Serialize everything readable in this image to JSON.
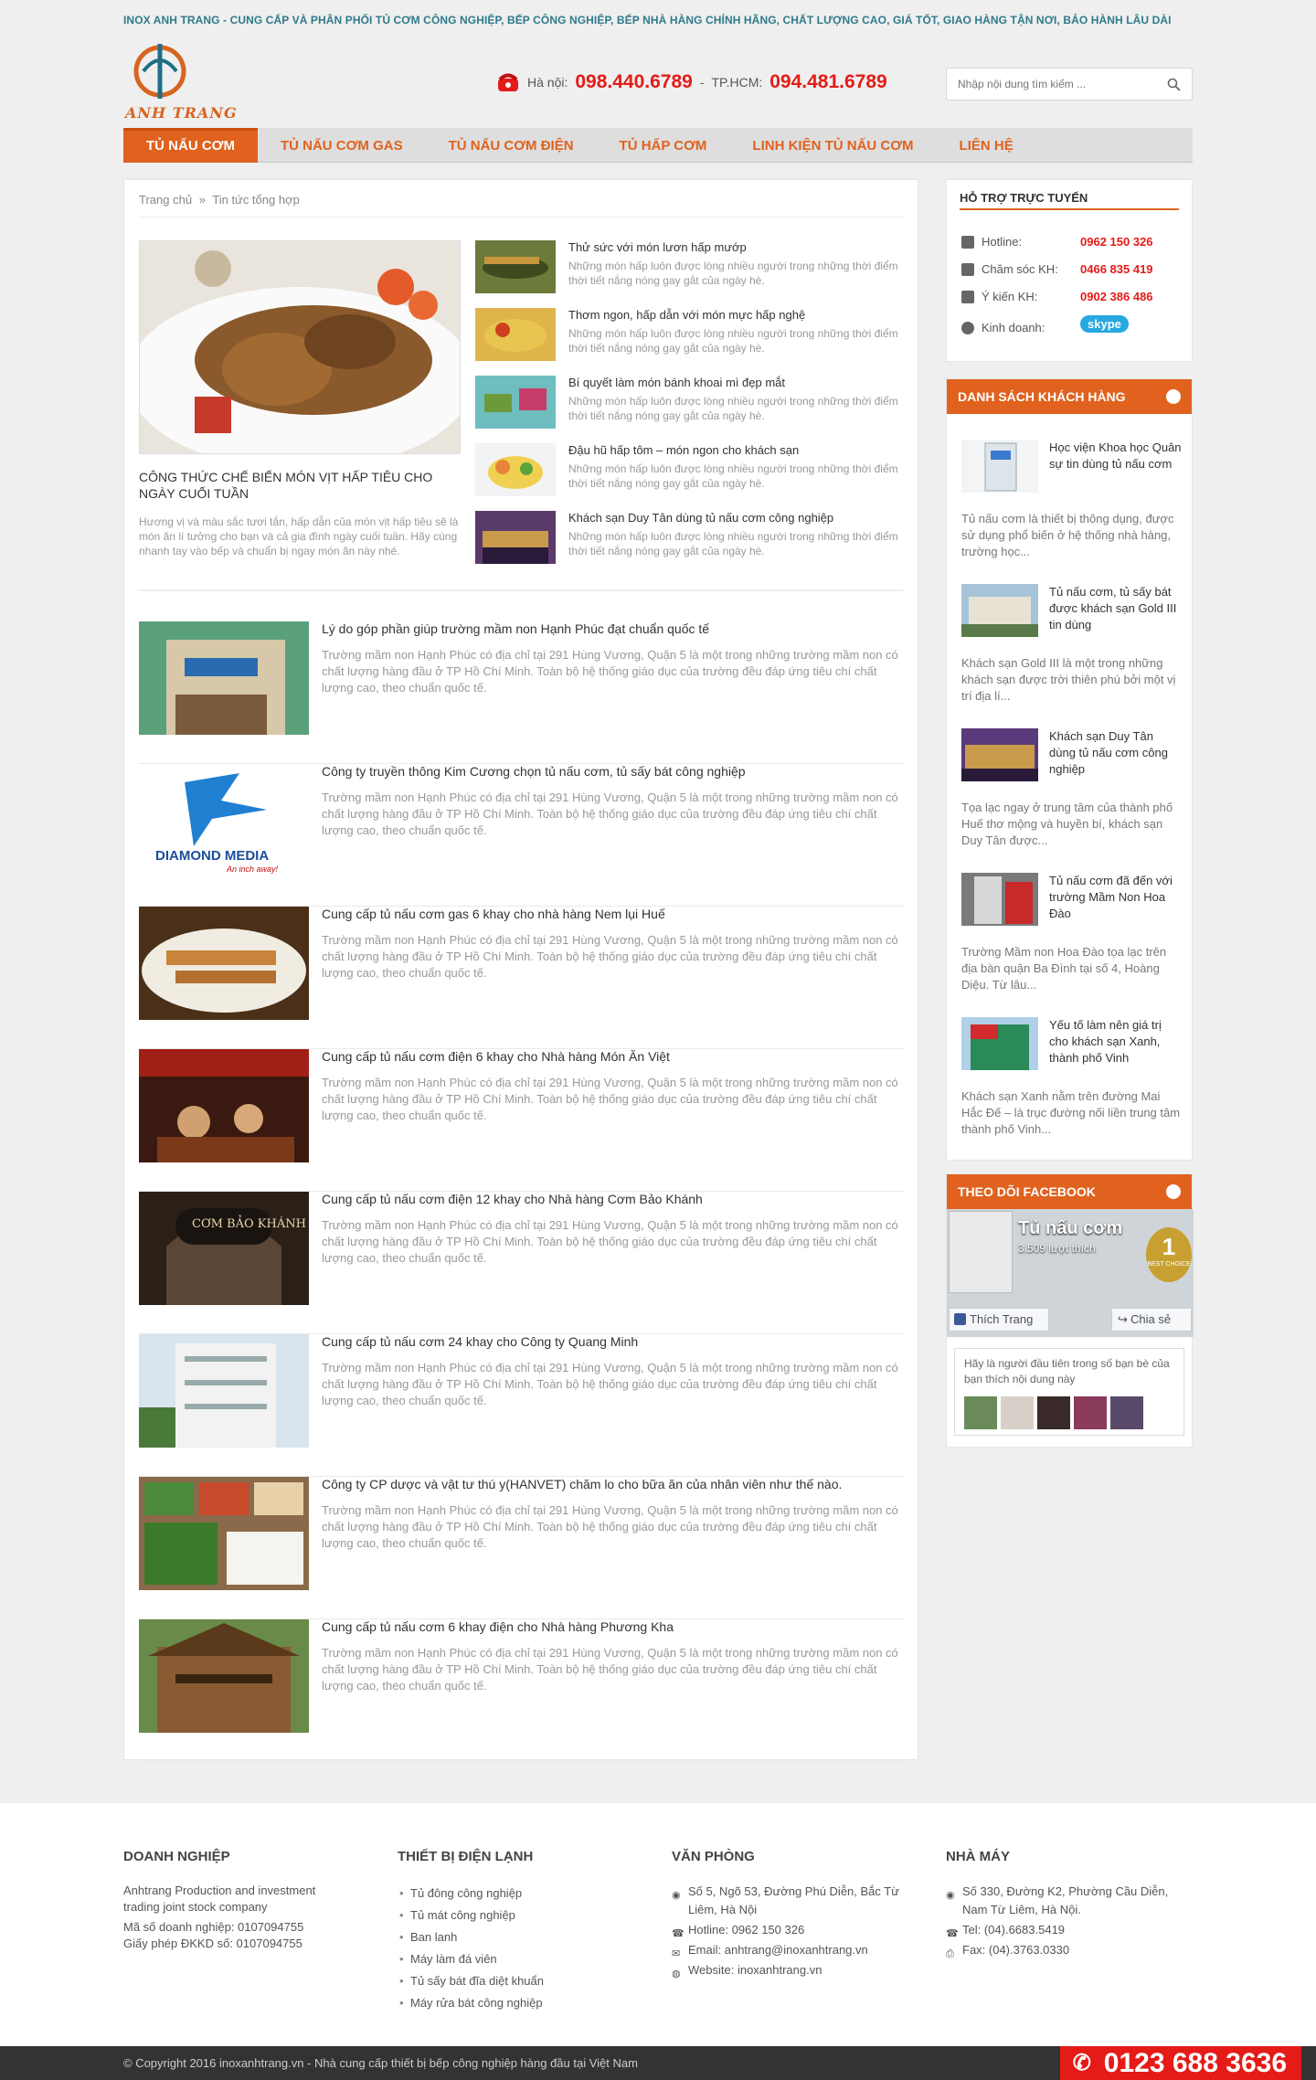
{
  "topbar": {
    "text": "INOX ANH TRANG - CUNG CẤP VÀ PHÂN PHỐI TỦ CƠM CÔNG NGHIỆP, BẾP CÔNG NGHIỆP, BẾP NHÀ HÀNG CHÍNH HÃNG, CHẤT LƯỢNG CAO, GIÁ TỐT, GIAO HÀNG TẬN NƠI, BẢO HÀNH LÂU DÀI"
  },
  "logo": {
    "text": "ANH TRANG"
  },
  "hotline": {
    "hanoi_label": "Hà nội:",
    "hanoi_number": "098.440.6789",
    "sep": "-",
    "hcm_label": "TP.HCM:",
    "hcm_number": "094.481.6789"
  },
  "search": {
    "placeholder": "Nhập nội dung tìm kiếm ..."
  },
  "nav": {
    "items": [
      {
        "label": "TỦ NẤU CƠM"
      },
      {
        "label": "TỦ NẤU CƠM GAS"
      },
      {
        "label": "TỦ NẤU CƠM ĐIỆN"
      },
      {
        "label": "TỦ HẤP CƠM"
      },
      {
        "label": "LINH KIỆN TỦ NẤU CƠM"
      },
      {
        "label": "LIÊN HỆ"
      }
    ]
  },
  "breadcrumb": {
    "home": "Trang chủ",
    "sep": "»",
    "current": "Tin tức tổng hợp"
  },
  "feature": {
    "title": "CÔNG THỨC CHẾ BIẾN MÓN VỊT HẤP TIÊU CHO NGÀY CUỐI TUẦN",
    "desc": "Hương vị và màu sắc tươi tắn, hấp dẫn của món vịt hấp tiêu sẽ là món ăn lí tưởng cho bạn và cả gia đình ngày cuối tuần. Hãy cùng nhanh tay vào bếp và chuẩn bị ngay món ăn này nhé."
  },
  "small_news": [
    {
      "title": "Thử sức với món lươn hấp mướp",
      "desc": "Những món hấp luôn được lòng nhiều người trong những thời điểm thời tiết nắng nóng gay gắt của ngày hè."
    },
    {
      "title": "Thơm ngon, hấp dẫn với món mực hấp nghệ",
      "desc": "Những món hấp luôn được lòng nhiều người trong những thời điểm thời tiết nắng nóng gay gắt của ngày hè."
    },
    {
      "title": "Bí quyết làm món bánh khoai mì đẹp mắt",
      "desc": "Những món hấp luôn được lòng nhiều người trong những thời điểm thời tiết nắng nóng gay gắt của ngày hè."
    },
    {
      "title": "Đậu hũ hấp tôm – món ngon cho khách sạn",
      "desc": "Những món hấp luôn được lòng nhiều người trong những thời điểm thời tiết nắng nóng gay gắt của ngày hè."
    },
    {
      "title": "Khách sạn Duy Tân dùng tủ nấu cơm công nghiệp",
      "desc": "Những món hấp luôn được lòng nhiều người trong những thời điểm thời tiết nắng nóng gay gắt của ngày hè."
    }
  ],
  "news": [
    {
      "title": "Lý do góp phần giúp trường mầm non Hạnh Phúc đạt chuẩn quốc tế",
      "desc": "Trường mầm non Hạnh Phúc có địa chỉ tại 291 Hùng Vương, Quận 5 là một trong những trường mầm non có chất lượng hàng đầu ở TP Hồ Chí Minh. Toàn bộ hệ thống giáo dục của trường đều đáp ứng tiêu chí chất lượng cao, theo chuẩn quốc tế."
    },
    {
      "title": "Công ty truyền thông Kim Cương chọn tủ nấu cơm, tủ sấy bát công nghiệp",
      "desc": "Trường mầm non Hạnh Phúc có địa chỉ tại 291 Hùng Vương, Quận 5 là một trong những trường mầm non có chất lượng hàng đầu ở TP Hồ Chí Minh. Toàn bộ hệ thống giáo dục của trường đều đáp ứng tiêu chí chất lượng cao, theo chuẩn quốc tế.",
      "logo_text": "DIAMOND MEDIA",
      "logo_sub": "An inch away!"
    },
    {
      "title": "Cung cấp tủ nấu cơm gas 6 khay cho nhà hàng Nem lụi Huế",
      "desc": "Trường mầm non Hạnh Phúc có địa chỉ tại 291 Hùng Vương, Quận 5 là một trong những trường mầm non có chất lượng hàng đầu ở TP Hồ Chí Minh. Toàn bộ hệ thống giáo dục của trường đều đáp ứng tiêu chí chất lượng cao, theo chuẩn quốc tế."
    },
    {
      "title": "Cung cấp tủ nấu cơm điện 6 khay cho Nhà hàng Món Ăn Việt",
      "desc": "Trường mầm non Hạnh Phúc có địa chỉ tại 291 Hùng Vương, Quận 5 là một trong những trường mầm non có chất lượng hàng đầu ở TP Hồ Chí Minh. Toàn bộ hệ thống giáo dục của trường đều đáp ứng tiêu chí chất lượng cao, theo chuẩn quốc tế."
    },
    {
      "title": "Cung cấp tủ nấu cơm điện 12 khay cho Nhà hàng Cơm Bảo Khánh",
      "desc": "Trường mầm non Hạnh Phúc có địa chỉ tại 291 Hùng Vương, Quận 5 là một trong những trường mầm non có chất lượng hàng đầu ở TP Hồ Chí Minh. Toàn bộ hệ thống giáo dục của trường đều đáp ứng tiêu chí chất lượng cao, theo chuẩn quốc tế.",
      "sign_text": "CƠM BẢO KHÁNH"
    },
    {
      "title": "Cung cấp tủ nấu cơm 24 khay cho Công ty Quang Minh",
      "desc": "Trường mầm non Hạnh Phúc có địa chỉ tại 291 Hùng Vương, Quận 5 là một trong những trường mầm non có chất lượng hàng đầu ở TP Hồ Chí Minh. Toàn bộ hệ thống giáo dục của trường đều đáp ứng tiêu chí chất lượng cao, theo chuẩn quốc tế."
    },
    {
      "title": "Công ty CP dược và vật tư thú y(HANVET) chăm lo cho bữa ăn của nhân viên như thế nào.",
      "desc": "Trường mầm non Hạnh Phúc có địa chỉ tại 291 Hùng Vương, Quận 5 là một trong những trường mầm non có chất lượng hàng đầu ở TP Hồ Chí Minh. Toàn bộ hệ thống giáo dục của trường đều đáp ứng tiêu chí chất lượng cao, theo chuẩn quốc tế."
    },
    {
      "title": "Cung cấp tủ nấu cơm 6 khay điện cho Nhà hàng Phương Kha",
      "desc": "Trường mầm non Hạnh Phúc có địa chỉ tại 291 Hùng Vương, Quận 5 là một trong những trường mầm non có chất lượng hàng đầu ở TP Hồ Chí Minh. Toàn bộ hệ thống giáo dục của trường đều đáp ứng tiêu chí chất lượng cao, theo chuẩn quốc tế."
    }
  ],
  "support": {
    "title": "HỖ TRỢ TRỰC TUYẾN",
    "rows": [
      {
        "label": "Hotline:",
        "value": "0962 150 326"
      },
      {
        "label": "Chăm sóc KH:",
        "value": "0466 835 419"
      },
      {
        "label": "Ý kiến KH:",
        "value": "0902 386 486"
      },
      {
        "label": "Kinh doanh:",
        "value": "skype"
      }
    ]
  },
  "customers": {
    "title": "DANH SÁCH KHÁCH HÀNG",
    "items": [
      {
        "title": "Học viện Khoa học Quân sự tin dùng tủ nấu cơm",
        "desc": "Tủ nấu cơm là thiết bị thông dụng, được sử dụng phổ biến ở hệ thống nhà hàng, trường học..."
      },
      {
        "title": "Tủ nấu cơm, tủ sấy bát được khách sạn Gold III tin dùng",
        "desc": "Khách sạn Gold III là một trong những khách sạn được trời thiên phú bởi một vị trí địa lí..."
      },
      {
        "title": "Khách sạn Duy Tân dùng tủ nấu cơm công nghiệp",
        "desc": "Tọa lạc ngay ở trung tâm của thành phố Huế thơ mộng và huyền bí, khách sạn Duy Tân được..."
      },
      {
        "title": "Tủ nấu cơm đã đến với trường Mầm Non Hoa Đào",
        "desc": "Trường Mầm non Hoa Đào tọa lạc trên địa bàn quận Ba Đình tại số 4, Hoàng Diệu. Từ lâu..."
      },
      {
        "title": "Yếu tố làm nên giá trị cho khách sạn Xanh, thành phố Vinh",
        "desc": "Khách sạn Xanh nằm trên đường Mai Hắc Đế – là trục đường nối liền trung tâm thành phố Vinh..."
      }
    ]
  },
  "facebook": {
    "title": "THEO DÕI FACEBOOK",
    "page_name": "Tủ nấu cơm",
    "likes": "3.509 lượt thích",
    "like_btn": "Thích Trang",
    "share_btn": "Chia sẻ",
    "cta": "Hãy là người đầu tiên trong số bạn bè của bạn thích nội dung này",
    "badge": "1",
    "badge_sub": "BEST CHOICE"
  },
  "footer": {
    "col1": {
      "title": "DOANH NGHIỆP",
      "lines": [
        "Anhtrang Production and investment trading joint stock company",
        "Mã số doanh nghiệp: 0107094755",
        "Giấy phép ĐKKD số: 0107094755"
      ]
    },
    "col2": {
      "title": "THIẾT BỊ ĐIỆN LẠNH",
      "items": [
        "Tủ đông công nghiệp",
        "Tủ mát công nghiệp",
        "Ban lanh",
        "Máy làm đá viên",
        "Tủ sấy bát đĩa diệt khuẩn",
        "Máy rửa bát công nghiệp"
      ]
    },
    "col3": {
      "title": "VĂN PHÒNG",
      "address": "Số 5, Ngõ 53, Đường Phú Diễn, Bắc Từ Liêm, Hà Nội",
      "hotline": "Hotline: 0962 150 326",
      "email": "Email: anhtrang@inoxanhtrang.vn",
      "website": "Website: inoxanhtrang.vn"
    },
    "col4": {
      "title": "NHÀ MÁY",
      "address": "Số 330, Đường K2, Phường Cầu Diễn, Nam Từ Liêm, Hà Nội.",
      "tel": "Tel: (04).6683.5419",
      "fax": "Fax: (04).3763.0330"
    }
  },
  "bottom": {
    "copyright": "© Copyright 2016 inoxanhtrang.vn - Nhà cung cấp thiết bị bếp công nghiệp hàng đầu tại Việt Nam",
    "hotline": "0123 688 3636"
  },
  "colors": {
    "accent": "#e0621e",
    "red": "#e41b17",
    "teal": "#2f7a8c"
  }
}
